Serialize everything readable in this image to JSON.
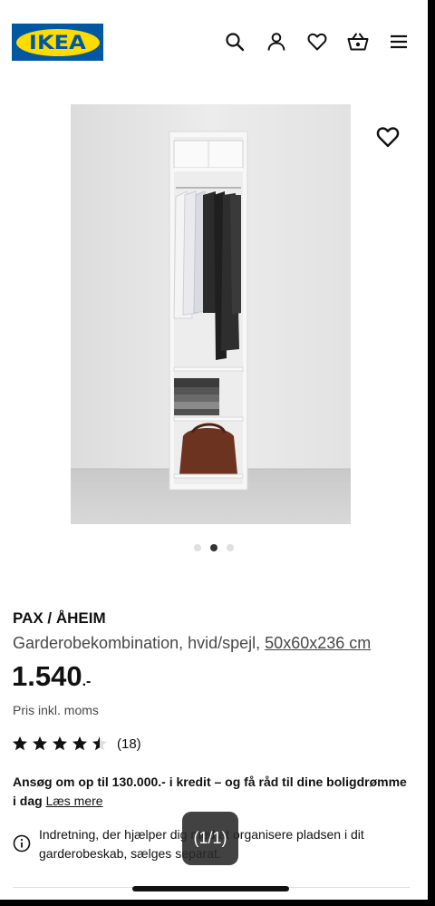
{
  "header": {
    "logo_text": "IKEA",
    "icons": [
      "search-icon",
      "user-icon",
      "heart-icon",
      "basket-icon",
      "menu-icon"
    ]
  },
  "gallery": {
    "total_images": 3,
    "active_index": 1
  },
  "product": {
    "name": "PAX / ÅHEIM",
    "description": "Garderobekombination, hvid/spejl,",
    "measurement": "50x60x236 cm",
    "price": "1.540",
    "price_suffix": ".-",
    "price_note": "Pris inkl. moms",
    "rating": 4.5,
    "rating_max": 5,
    "review_count": "(18)"
  },
  "credit": {
    "text": "Ansøg om op til 130.000.- i kredit – og få råd til dine boligdrømme i dag",
    "link": "Læs mere"
  },
  "info": {
    "text": "Indretning, der hjælper dig med at organisere pladsen i dit garderobeskab, sælges separat."
  },
  "overlay": {
    "page_indicator": "(1/1)"
  },
  "colors": {
    "brand_blue": "#0058a3",
    "brand_yellow": "#ffdb00",
    "text": "#111111",
    "secondary_text": "#484848"
  }
}
